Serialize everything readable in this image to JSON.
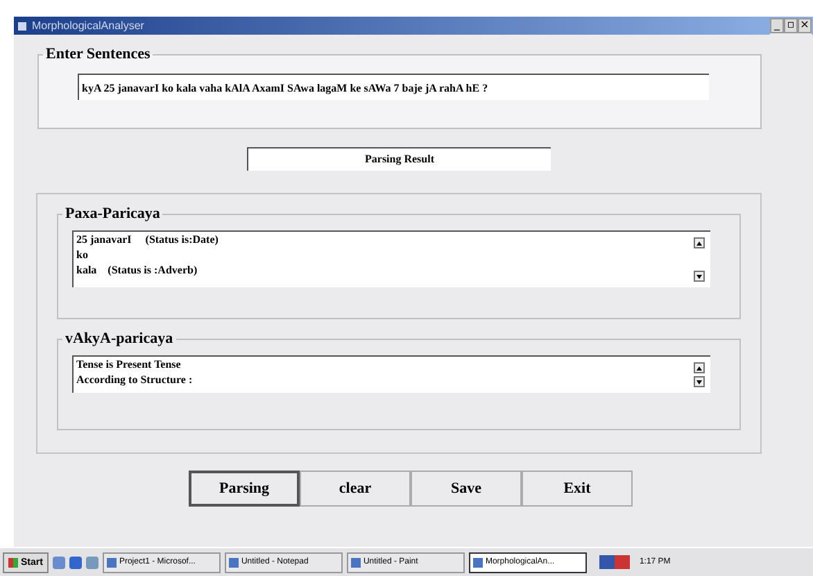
{
  "window": {
    "title": "MorphologicalAnalyser",
    "controls": [
      "_",
      "▫",
      "×"
    ]
  },
  "enter_sentences": {
    "title": "Enter Sentences",
    "value": "kyA 25 janavarI ko kala vaha kAlA AxamI SAwa lagaM ke sAWa 7 baje jA rahA hE ?"
  },
  "result_label": "Parsing Result",
  "paxa_paricaya": {
    "title": "Paxa-Paricaya",
    "lines": [
      "25 janavarI     (Status is:Date)",
      "ko",
      "kala    (Status is :Adverb)"
    ]
  },
  "vakya_paricaya": {
    "title": "vAkyA-paricaya",
    "lines": [
      "Tense is Present Tense",
      "According to Structure :"
    ]
  },
  "buttons": [
    {
      "label": "Parsing",
      "selected": true
    },
    {
      "label": "clear",
      "selected": false
    },
    {
      "label": "Save",
      "selected": false
    },
    {
      "label": "Exit",
      "selected": false
    }
  ],
  "taskbar": {
    "start": "Start",
    "tasks": [
      {
        "label": "Project1 - Microsof...",
        "selected": false
      },
      {
        "label": "Untitled - Notepad",
        "selected": false
      },
      {
        "label": "Untitled - Paint",
        "selected": false
      },
      {
        "label": "MorphologicalAn...",
        "selected": true
      }
    ],
    "clock": "1:17 PM"
  }
}
